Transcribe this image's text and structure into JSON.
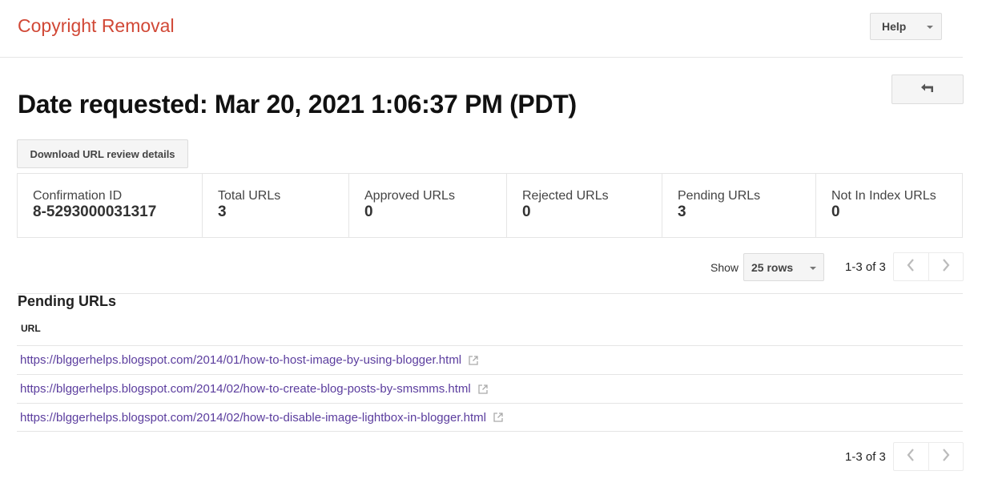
{
  "header": {
    "app_title": "Copyright Removal",
    "help_label": "Help"
  },
  "page": {
    "title": "Date requested: Mar 20, 2021 1:06:37 PM (PDT)",
    "download_label": "Download URL review details",
    "back_icon": "reply-arrow-icon"
  },
  "stats": [
    {
      "label": "Confirmation ID",
      "value": "8-5293000031317"
    },
    {
      "label": "Total URLs",
      "value": "3"
    },
    {
      "label": "Approved URLs",
      "value": "0"
    },
    {
      "label": "Rejected URLs",
      "value": "0"
    },
    {
      "label": "Pending URLs",
      "value": "3"
    },
    {
      "label": "Not In Index URLs",
      "value": "0"
    }
  ],
  "pagination": {
    "show_label": "Show",
    "rows_selected": "25 rows",
    "range_text": "1-3 of 3"
  },
  "pending": {
    "title": "Pending URLs",
    "column_header": "URL",
    "urls": [
      "https://blggerhelps.blogspot.com/2014/01/how-to-host-image-by-using-blogger.html",
      "https://blggerhelps.blogspot.com/2014/02/how-to-create-blog-posts-by-smsmms.html",
      "https://blggerhelps.blogspot.com/2014/02/how-to-disable-image-lightbox-in-blogger.html"
    ]
  },
  "colors": {
    "brand_title": "#d14836",
    "link": "#5b3d9e",
    "border": "#e5e5e5",
    "button_bg": "#f5f5f5"
  }
}
